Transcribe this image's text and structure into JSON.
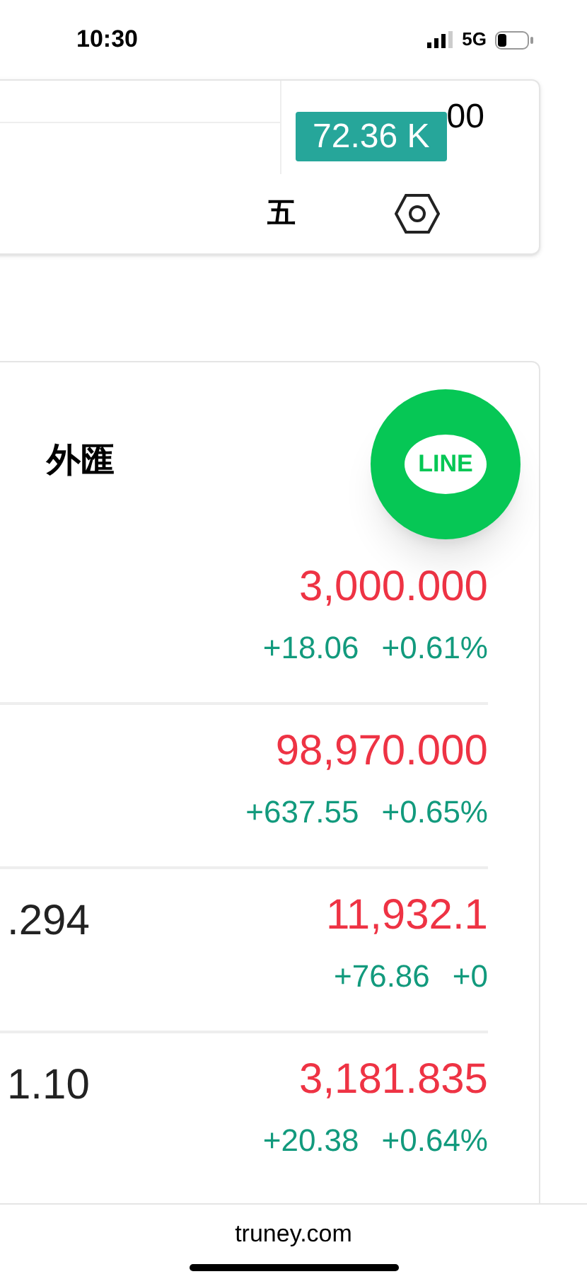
{
  "status_bar": {
    "time": "10:30",
    "network": "5G"
  },
  "top_card": {
    "badge": "72.36 K",
    "value_fragment": "00",
    "tab_label": "五"
  },
  "market_card": {
    "heading": "外匯",
    "rows": [
      {
        "column_1": "",
        "price": "3,000.000",
        "change": "+18.06",
        "percent": "+0.61%"
      },
      {
        "column_1": "",
        "price": "98,970.000",
        "change": "+637.55",
        "percent": "+0.65%"
      },
      {
        "column_1": ".294",
        "price": "11,932.1",
        "change": "+76.86",
        "percent": "+0"
      },
      {
        "column_1": "1.10",
        "price": "3,181.835",
        "change": "+20.38",
        "percent": "+0.64%"
      }
    ]
  },
  "line_button": {
    "label": "LINE"
  },
  "browser_bar": {
    "url": "truney.com"
  }
}
